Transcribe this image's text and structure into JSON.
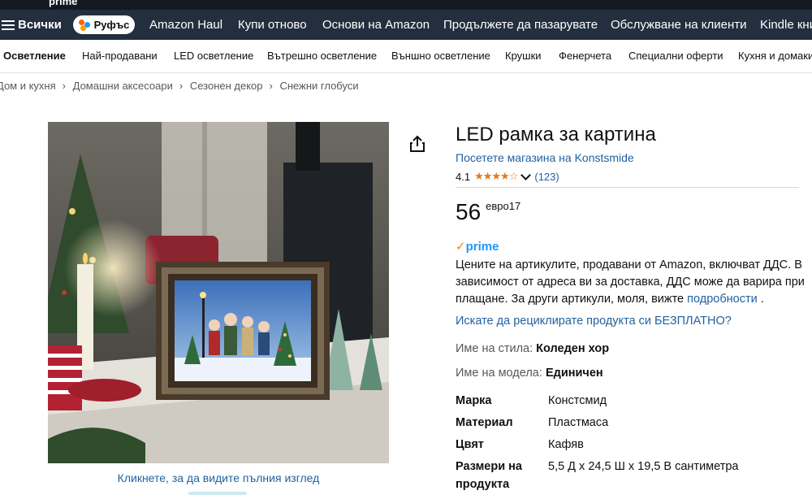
{
  "nav": {
    "all_label": "Всички",
    "rufus_label": "Руфъс",
    "items": [
      "Amazon Haul",
      "Купи отново",
      "Основи на Amazon",
      "Продължете да пазарувате",
      "Обслужване на клиенти",
      "Kindle книги"
    ],
    "top_peek": "prime"
  },
  "subnav": {
    "items": [
      "Осветление",
      "Най-продавани",
      "LED осветление",
      "Вътрешно осветление",
      "Външно осветление",
      "Крушки",
      "Фенерчета",
      "Специални оферти",
      "Кухня и домакинство"
    ]
  },
  "breadcrumb": [
    "Дом и кухня",
    "Домашни аксесоари",
    "Сезонен декор",
    "Снежни глобуси"
  ],
  "image": {
    "click_full_label": "Кликнете, за да видите пълния изглед"
  },
  "product": {
    "title": "LED рамка за картина",
    "store_link": "Посетете магазина на Konstsmide",
    "rating_value": "4.1",
    "stars": "★★★★☆",
    "rating_count": "(123)",
    "price_whole": "56",
    "price_fraction": "евро17",
    "prime_label": "prime",
    "vat_text": "Цените на артикулите, продавани от Amazon, включват ДДС. В зависимост от адреса ви за доставка, ДДС може да варира при плащане. За други артикули, моля, вижте",
    "vat_link": "подробности",
    "vat_end": ".",
    "recycle_link": "Искате да рециклирате продукта си БЕЗПЛАТНО?",
    "style_label": "Име на стила:",
    "style_value": "Коледен хор",
    "model_label": "Име на модела:",
    "model_value": "Единичен"
  },
  "specs": [
    {
      "key": "Марка",
      "value": "Констсмид"
    },
    {
      "key": "Материал",
      "value": "Пластмаса"
    },
    {
      "key": "Цвят",
      "value": "Кафяв"
    },
    {
      "key": "Размери на продукта",
      "value": "5,5 Д x 24,5 Ш x 19,5 В сантиметра"
    }
  ],
  "colors": {
    "nav_bg": "#232f3e",
    "top_bg": "#131921",
    "link": "#2162a1",
    "star": "#de7921",
    "prime_blue": "#1a98ff"
  }
}
